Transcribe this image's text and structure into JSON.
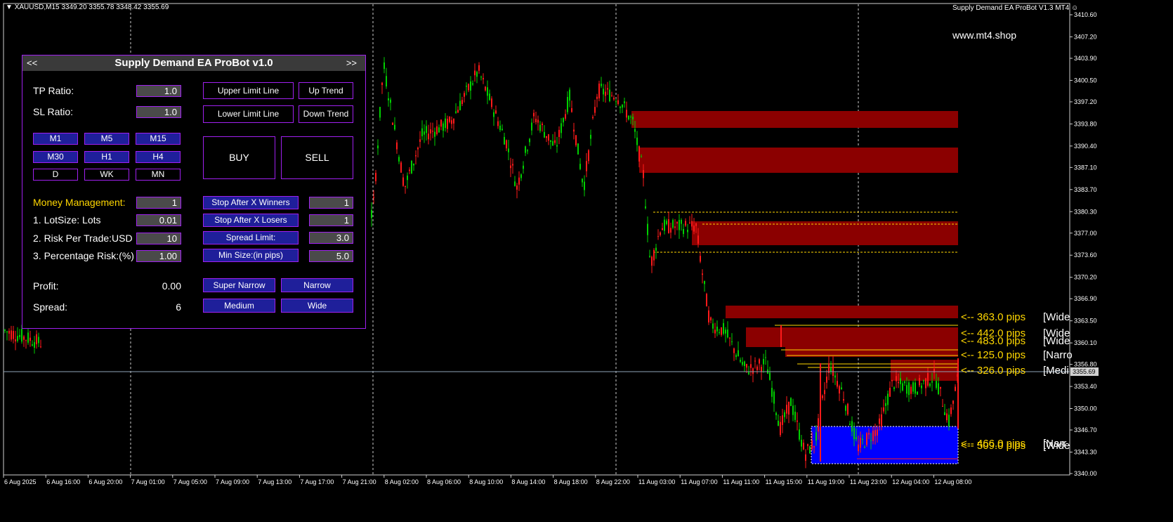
{
  "header": {
    "symbol_info": "XAUUSD,M15  3349.20 3355.78 3348.42 3355.69",
    "ea_name": "Supply Demand EA ProBot V1.3 MT4",
    "website": "www.mt4.shop"
  },
  "panel": {
    "title": "Supply Demand EA ProBot v1.0",
    "nav_prev": "<<",
    "nav_next": ">>",
    "tp_ratio_label": "TP Ratio:",
    "tp_ratio_value": "1.0",
    "sl_ratio_label": "SL Ratio:",
    "sl_ratio_value": "1.0",
    "timeframes": [
      "M1",
      "M5",
      "M15",
      "M30",
      "H1",
      "H4",
      "D",
      "WK",
      "MN"
    ],
    "upper_limit_line": "Upper Limit Line",
    "up_trend": "Up Trend",
    "lower_limit_line": "Lower Limit Line",
    "down_trend": "Down Trend",
    "buy": "BUY",
    "sell": "SELL",
    "money_management_label": "Money Management:",
    "money_management_value": "1",
    "lotsize_label": "1. LotSize: Lots",
    "lotsize_value": "0.01",
    "risk_trade_label": "2. Risk Per Trade:USD",
    "risk_trade_value": "10",
    "pct_risk_label": "3. Percentage Risk:(%)",
    "pct_risk_value": "1.00",
    "stop_winners": "Stop After X Winners",
    "stop_winners_value": "1",
    "stop_losers": "Stop After X Losers",
    "stop_losers_value": "1",
    "spread_limit": "Spread Limit:",
    "spread_limit_value": "3.0",
    "min_size": "Min Size:(in pips)",
    "min_size_value": "5.0",
    "profit_label": "Profit:",
    "profit_value": "0.00",
    "spread_label": "Spread:",
    "spread_value": "6",
    "super_narrow": "Super Narrow",
    "narrow": "Narrow",
    "medium": "Medium",
    "wide": "Wide"
  },
  "price_axis": [
    "3410.60",
    "3407.20",
    "3403.90",
    "3400.50",
    "3397.20",
    "3393.80",
    "3390.40",
    "3387.10",
    "3383.70",
    "3380.30",
    "3377.00",
    "3373.60",
    "3370.20",
    "3366.90",
    "3363.50",
    "3360.10",
    "3356.80",
    "3353.40",
    "3350.00",
    "3346.70",
    "3343.30",
    "3340.00"
  ],
  "current_price": "3355.69",
  "time_axis": [
    "6 Aug 2025",
    "6 Aug 16:00",
    "6 Aug 20:00",
    "7 Aug 01:00",
    "7 Aug 05:00",
    "7 Aug 09:00",
    "7 Aug 13:00",
    "7 Aug 17:00",
    "7 Aug 21:00",
    "8 Aug 02:00",
    "8 Aug 06:00",
    "8 Aug 10:00",
    "8 Aug 14:00",
    "8 Aug 18:00",
    "8 Aug 22:00",
    "11 Aug 03:00",
    "11 Aug 07:00",
    "11 Aug 11:00",
    "11 Aug 15:00",
    "11 Aug 19:00",
    "11 Aug 23:00",
    "12 Aug 04:00",
    "12 Aug 08:00"
  ],
  "zone_labels": [
    {
      "pips": "<-- 363.0 pips",
      "type": "[Wide"
    },
    {
      "pips": "<-- 442.0 pips",
      "type": "[Wide"
    },
    {
      "pips": "<-- 483.0 pips",
      "type": "[Wide"
    },
    {
      "pips": "<-- 125.0 pips",
      "type": "[Narro"
    },
    {
      "pips": "<-- 326.0 pips",
      "type": "[Medi"
    },
    {
      "pips": "<-- 466.0 pips",
      "type": "[Narr"
    },
    {
      "pips": "<-- 509.0 pips",
      "type": "[Wide"
    }
  ],
  "colors": {
    "bull": "#00d000",
    "bear": "#ff1a1a",
    "supply_zone": "#8b0000",
    "demand_zone": "#0000ff",
    "zone_label": "#ffd700",
    "panel_border": "#a020f0",
    "button_blue": "#1f1f9a"
  }
}
